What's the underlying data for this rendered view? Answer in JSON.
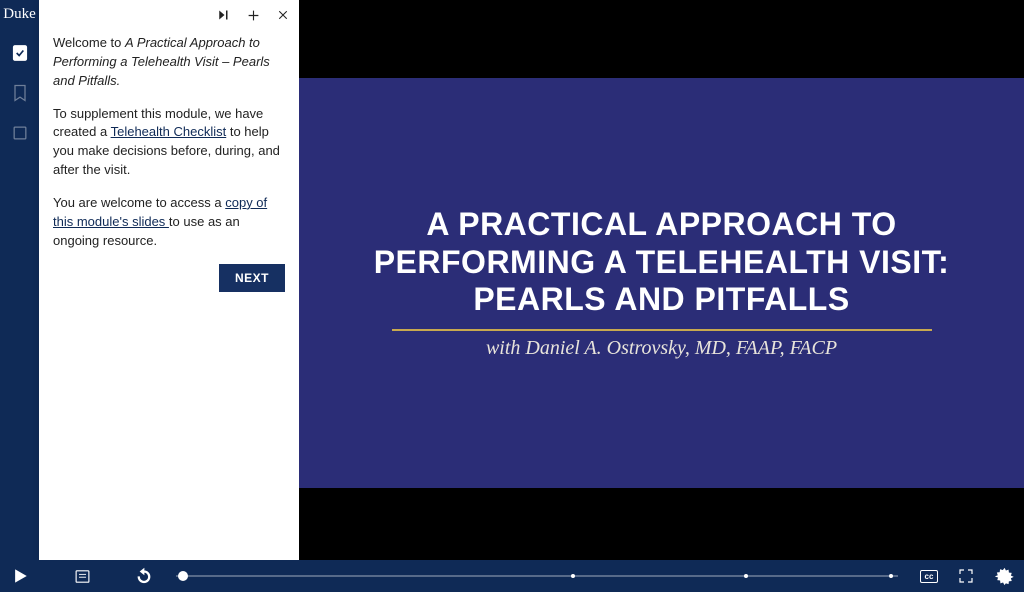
{
  "brand": "Duke",
  "panel": {
    "intro_prefix": "Welcome to ",
    "intro_title": "A Practical Approach to Performing a Telehealth Visit – Pearls and Pitfalls.",
    "p2_a": "To supplement this module, we have created a ",
    "p2_link": "Telehealth Checklist",
    "p2_b": " to help you make decisions before, during, and after the visit.",
    "p3_a": "You are welcome to access a ",
    "p3_link": "copy of this module's slides ",
    "p3_b": "to use as an ongoing resource.",
    "next_label": "NEXT"
  },
  "slide": {
    "title": "A PRACTICAL APPROACH TO PERFORMING A TELEHEALTH VISIT: PEARLS AND PITFALLS",
    "subtitle": "with Daniel A. Ostrovsky, MD, FAAP, FACP"
  },
  "player": {
    "cc_label": "cc"
  }
}
